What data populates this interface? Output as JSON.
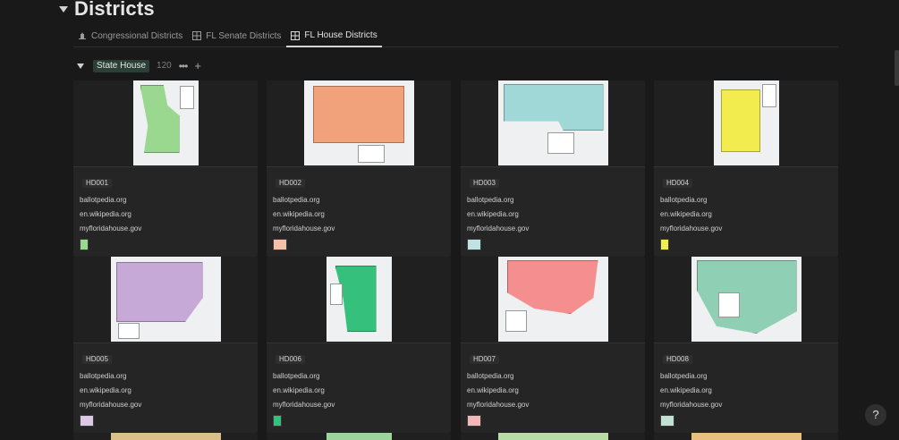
{
  "page": {
    "title": "Districts"
  },
  "tabs": [
    {
      "label": "Congressional Districts",
      "icon": "capitol-icon",
      "active": false
    },
    {
      "label": "FL Senate Districts",
      "icon": "gallery-icon",
      "active": false
    },
    {
      "label": "FL House Districts",
      "icon": "gallery-icon",
      "active": true
    }
  ],
  "group": {
    "label": "State House",
    "count": "120"
  },
  "cards": [
    {
      "code": "HD001",
      "links": [
        "ballotpedia.org",
        "en.wikipedia.org",
        "myfloridahouse.gov"
      ],
      "fill": "#9bd88f"
    },
    {
      "code": "HD002",
      "links": [
        "ballotpedia.org",
        "en.wikipedia.org",
        "myfloridahouse.gov"
      ],
      "fill": "#f2a27a"
    },
    {
      "code": "HD003",
      "links": [
        "ballotpedia.org",
        "en.wikipedia.org",
        "myfloridahouse.gov"
      ],
      "fill": "#9fd8d6"
    },
    {
      "code": "HD004",
      "links": [
        "ballotpedia.org",
        "en.wikipedia.org",
        "myfloridahouse.gov"
      ],
      "fill": "#f2ec4f"
    },
    {
      "code": "HD005",
      "links": [
        "ballotpedia.org",
        "en.wikipedia.org",
        "myfloridahouse.gov"
      ],
      "fill": "#c7a9d8"
    },
    {
      "code": "HD006",
      "links": [
        "ballotpedia.org",
        "en.wikipedia.org",
        "myfloridahouse.gov"
      ],
      "fill": "#35c17c"
    },
    {
      "code": "HD007",
      "links": [
        "ballotpedia.org",
        "en.wikipedia.org",
        "myfloridahouse.gov"
      ],
      "fill": "#f58f8f"
    },
    {
      "code": "HD008",
      "links": [
        "ballotpedia.org",
        "en.wikipedia.org",
        "myfloridahouse.gov"
      ],
      "fill": "#8fcfb3"
    },
    {
      "fill": "#d9c189"
    },
    {
      "fill": "#9dd49a"
    },
    {
      "fill": "#b9dca6"
    },
    {
      "fill": "#e8c080"
    }
  ],
  "help": {
    "label": "?"
  }
}
